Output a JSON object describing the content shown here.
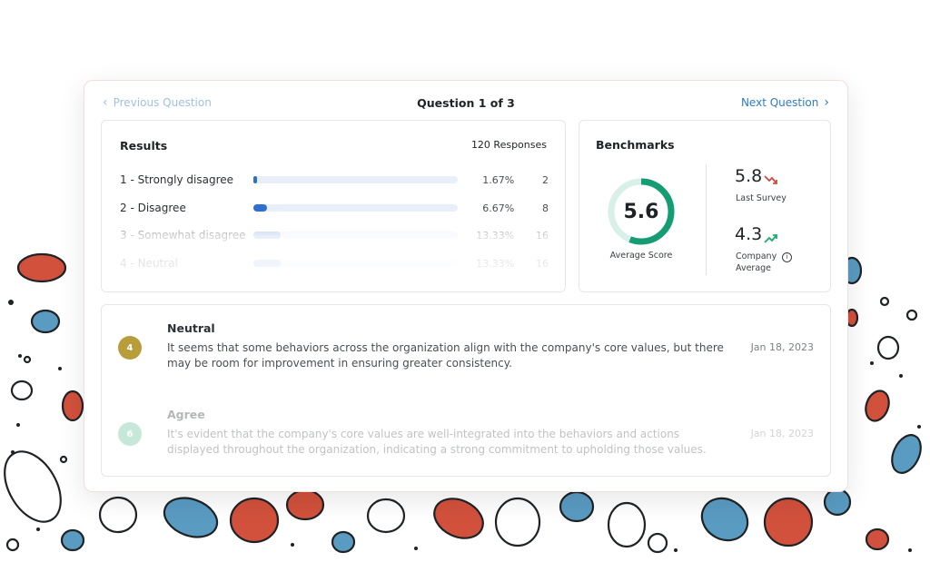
{
  "colors": {
    "accent_blue": "#2f6fd0",
    "nav_link": "#2e7bc6",
    "gauge_green": "#159c73",
    "gauge_track": "#d9f0e8",
    "trend_down": "#d14b43",
    "trend_up": "#1faa6f",
    "badge_neutral": "#b89d3a",
    "badge_agree": "#9bd7c0",
    "blob_red": "#d2513c",
    "blob_blue": "#5a9bc2"
  },
  "navigation": {
    "previous_label": "Previous Question",
    "title": "Question 1 of 3",
    "next_label": "Next Question",
    "prev_icon": "chevron-left-icon",
    "next_icon": "chevron-right-icon"
  },
  "results": {
    "title": "Results",
    "responses": "120 Responses",
    "rows": [
      {
        "label": "1 - Strongly disagree",
        "pct": "1.67%",
        "count": "2",
        "fraction": 0.0167
      },
      {
        "label": "2 - Disagree",
        "pct": "6.67%",
        "count": "8",
        "fraction": 0.0667
      },
      {
        "label": "3 - Somewhat disagree",
        "pct": "13.33%",
        "count": "16",
        "fraction": 0.1333
      },
      {
        "label": "4 - Neutral",
        "pct": "13.33%",
        "count": "16",
        "fraction": 0.1333
      }
    ]
  },
  "benchmarks": {
    "title": "Benchmarks",
    "average_score": "5.6",
    "average_label": "Average Score",
    "score_fraction": 0.56,
    "last_survey_value": "5.8",
    "last_survey_label": "Last Survey",
    "last_survey_trend": "trend-down-icon",
    "company_value": "4.3",
    "company_label_1": "Company",
    "company_label_2": "Average",
    "company_trend": "trend-up-icon",
    "info_icon": "info-icon"
  },
  "comments": [
    {
      "score": "4",
      "title": "Neutral",
      "body": "It seems that some behaviors across the organization align with the company's core values, but there may be room for improvement in ensuring greater consistency.",
      "date": "Jan 18, 2023"
    },
    {
      "score": "6",
      "title": "Agree",
      "body": "It's evident that the company's core values are well-integrated into the behaviors and actions displayed throughout the organization, indicating a strong commitment to upholding those values.",
      "date": "Jan 18, 2023"
    }
  ]
}
